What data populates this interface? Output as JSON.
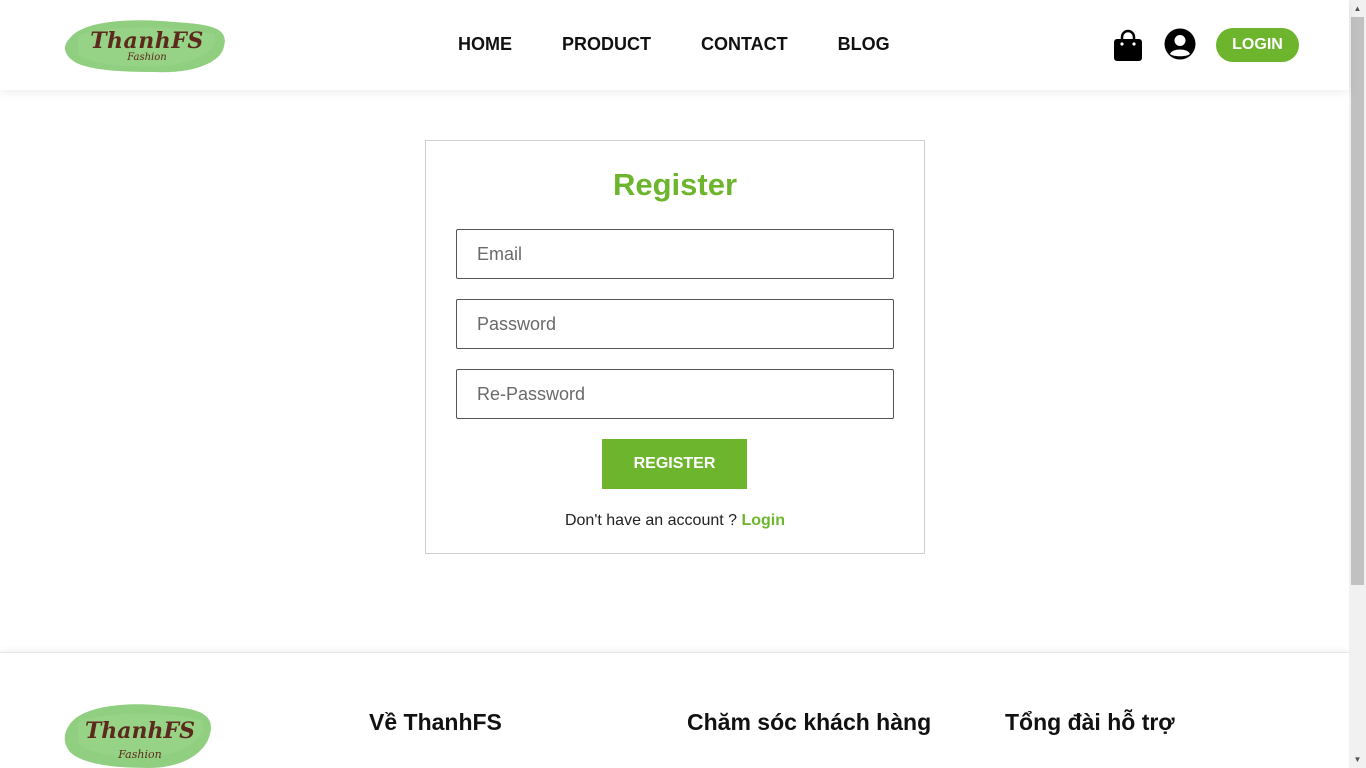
{
  "brand": {
    "logo_text": "ThanhFS",
    "logo_sub": "Fashion",
    "accent_color": "#6db52d"
  },
  "nav": {
    "items": [
      {
        "label": "HOME"
      },
      {
        "label": "PRODUCT"
      },
      {
        "label": "CONTACT"
      },
      {
        "label": "BLOG"
      }
    ],
    "cart_icon": "shopping-bag-icon",
    "user_icon": "user-circle-icon",
    "login_label": "LOGIN"
  },
  "register": {
    "title": "Register",
    "email_placeholder": "Email",
    "password_placeholder": "Password",
    "repassword_placeholder": "Re-Password",
    "submit_label": "REGISTER",
    "account_prompt": "Don't have an account ? ",
    "login_link": "Login"
  },
  "footer": {
    "headings": [
      "Về ThanhFS",
      "Chăm sóc khách hàng",
      "Tổng đài hỗ trợ"
    ]
  }
}
